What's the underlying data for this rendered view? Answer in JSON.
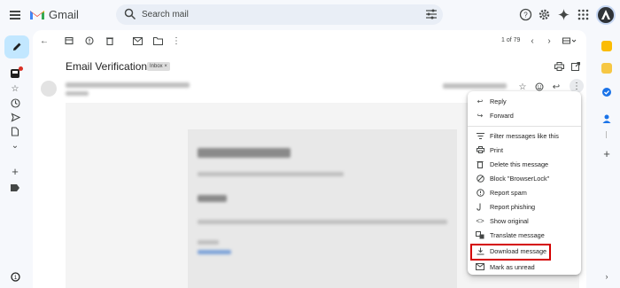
{
  "app": {
    "name": "Gmail"
  },
  "search": {
    "placeholder": "Search mail"
  },
  "toolbar": {
    "pager": "1 of 79"
  },
  "email": {
    "subject": "Email Verification",
    "label_chip": "Inbox ×"
  },
  "menu": {
    "items": [
      {
        "label": "Reply",
        "icon": "reply-icon"
      },
      {
        "label": "Forward",
        "icon": "forward-icon"
      },
      {
        "label": "Filter messages like this",
        "icon": "filter-icon"
      },
      {
        "label": "Print",
        "icon": "print-icon"
      },
      {
        "label": "Delete this message",
        "icon": "trash-icon"
      },
      {
        "label": "Block \"BrowserLock\"",
        "icon": "block-icon"
      },
      {
        "label": "Report spam",
        "icon": "spam-icon"
      },
      {
        "label": "Report phishing",
        "icon": "phishing-icon"
      },
      {
        "label": "Show original",
        "icon": "code-icon"
      },
      {
        "label": "Translate message",
        "icon": "translate-icon"
      },
      {
        "label": "Download message",
        "icon": "download-icon"
      },
      {
        "label": "Mark as unread",
        "icon": "mail-icon"
      }
    ]
  },
  "colors": {
    "highlight": "#d40000",
    "compose": "#c2e7ff",
    "search_bg": "#e9eef6"
  }
}
